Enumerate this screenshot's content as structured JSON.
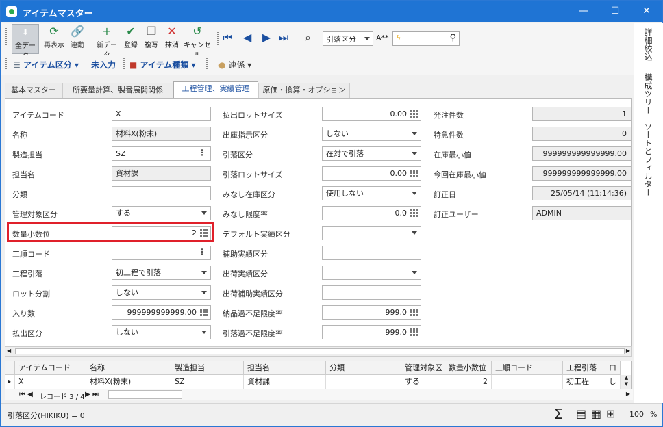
{
  "window": {
    "title": "アイテムマスター",
    "minimize": "—",
    "maximize": "☐",
    "close": "✕"
  },
  "toolbar": {
    "buttons": [
      {
        "label": "全データ",
        "icon": "download-icon",
        "glyph": "⬇"
      },
      {
        "label": "再表示",
        "icon": "refresh-icon",
        "glyph": "⟳"
      },
      {
        "label": "連動",
        "icon": "link-icon",
        "glyph": "🔗"
      },
      {
        "label": "新データ",
        "icon": "plus-icon",
        "glyph": "+"
      },
      {
        "label": "登録",
        "icon": "check-icon",
        "glyph": "✔"
      },
      {
        "label": "複写",
        "icon": "copy-icon",
        "glyph": "❐"
      },
      {
        "label": "抹消",
        "icon": "delete-icon",
        "glyph": "✕"
      },
      {
        "label": "キャンセル",
        "icon": "undo-icon",
        "glyph": "↺"
      }
    ],
    "nav": {
      "first": "⏮",
      "prev": "◀",
      "next": "▶",
      "last": "⏭"
    },
    "search_icon": "⚲",
    "field_combo": "引落区分",
    "match_label": "A**",
    "search_value": ""
  },
  "toolbar2": {
    "item_class": "アイテム区分",
    "unentered": "未入力",
    "item_type": "アイテム種類",
    "relation": "連係"
  },
  "tabs": [
    "基本マスター",
    "所要量計算、製番展開関係",
    "工程管理、実績管理",
    "原価・換算・オプション"
  ],
  "form": {
    "col1": [
      {
        "label": "アイテムコード",
        "value": "X",
        "type": "text"
      },
      {
        "label": "名称",
        "value": "材料X(粉末)",
        "type": "ro"
      },
      {
        "label": "製造担当",
        "value": "SZ",
        "type": "lookup"
      },
      {
        "label": "担当名",
        "value": "資材課",
        "type": "ro"
      },
      {
        "label": "分類",
        "value": "",
        "type": "text"
      },
      {
        "label": "管理対象区分",
        "value": "する",
        "type": "dropdown"
      },
      {
        "label": "数量小数位",
        "value": "2",
        "type": "num"
      },
      {
        "label": "工順コード",
        "value": "",
        "type": "lookup"
      },
      {
        "label": "工程引落",
        "value": "初工程で引落",
        "type": "dropdown"
      },
      {
        "label": "ロット分割",
        "value": "しない",
        "type": "dropdown"
      },
      {
        "label": "入り数",
        "value": "999999999999.00",
        "type": "num"
      },
      {
        "label": "払出区分",
        "value": "しない",
        "type": "dropdown"
      }
    ],
    "col2": [
      {
        "label": "払出ロットサイズ",
        "value": "0.00",
        "type": "num"
      },
      {
        "label": "出庫指示区分",
        "value": "しない",
        "type": "dropdown"
      },
      {
        "label": "引落区分",
        "value": "在対で引落",
        "type": "dropdown"
      },
      {
        "label": "引落ロットサイズ",
        "value": "0.00",
        "type": "num"
      },
      {
        "label": "みなし在庫区分",
        "value": "使用しない",
        "type": "dropdown"
      },
      {
        "label": "みなし限度率",
        "value": "0.0",
        "type": "num"
      },
      {
        "label": "デフォルト実績区分",
        "value": "",
        "type": "dropdown"
      },
      {
        "label": "補助実績区分",
        "value": "",
        "type": "text"
      },
      {
        "label": "出荷実績区分",
        "value": "",
        "type": "dropdown"
      },
      {
        "label": "出荷補助実績区分",
        "value": "",
        "type": "text"
      },
      {
        "label": "納品過不足限度率",
        "value": "999.0",
        "type": "num"
      },
      {
        "label": "引落過不足限度率",
        "value": "999.0",
        "type": "num"
      }
    ],
    "col3": [
      {
        "label": "発注件数",
        "value": "1",
        "type": "ronum"
      },
      {
        "label": "特急件数",
        "value": "0",
        "type": "ronum"
      },
      {
        "label": "在庫最小値",
        "value": "999999999999999.00",
        "type": "ronum"
      },
      {
        "label": "今回在庫最小値",
        "value": "999999999999999.00",
        "type": "ronum"
      },
      {
        "label": "訂正日",
        "value": "25/05/14 (11:14:36)",
        "type": "ronum"
      },
      {
        "label": "訂正ユーザー",
        "value": "ADMIN",
        "type": "ro"
      }
    ]
  },
  "table": {
    "headers": [
      "アイテムコード",
      "名称",
      "製造担当",
      "担当名",
      "分類",
      "管理対象区",
      "数量小数位",
      "工順コード",
      "工程引落",
      "ロ"
    ],
    "row": [
      "X",
      "材料X(粉末)",
      "SZ",
      "資材課",
      "",
      "する",
      "2",
      "",
      "初工程で...",
      "し"
    ],
    "pager": "レコード 3 / 4"
  },
  "status": {
    "text": "引落区分(HIKIKU) = 0",
    "zoom": "100",
    "percent": "%",
    "sigma": "Σ"
  },
  "side": [
    "詳細絞込",
    "構成ツリー",
    "ソートとフィルター"
  ],
  "colors": {
    "accent": "#1f74d4",
    "highlight": "#e0202a",
    "link": "#1b4fa0"
  }
}
